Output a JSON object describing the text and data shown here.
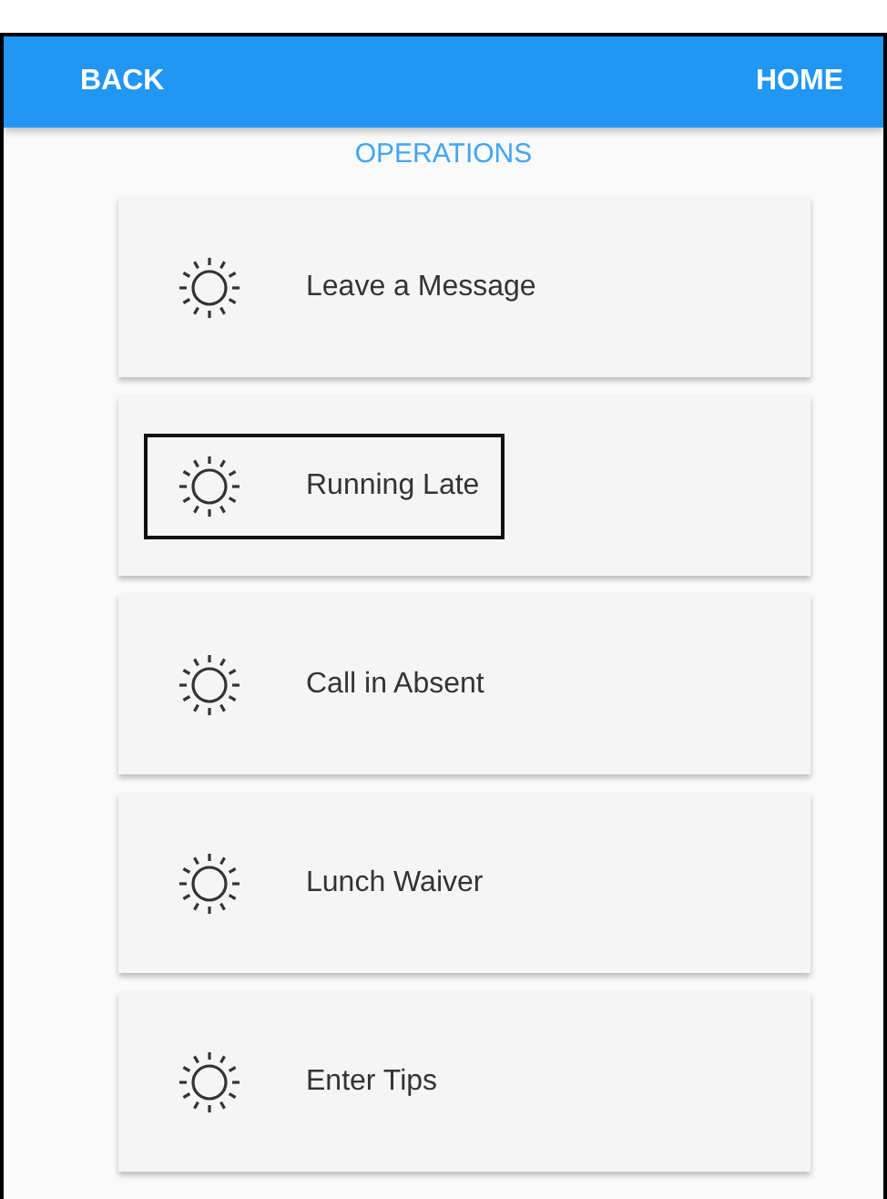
{
  "header": {
    "back": "BACK",
    "home": "HOME"
  },
  "section_title": "OPERATIONS",
  "items": [
    {
      "label": "Leave a Message",
      "focused": false
    },
    {
      "label": "Running Late",
      "focused": true
    },
    {
      "label": "Call in Absent",
      "focused": false
    },
    {
      "label": "Lunch Waiver",
      "focused": false
    },
    {
      "label": "Enter Tips",
      "focused": false
    }
  ]
}
